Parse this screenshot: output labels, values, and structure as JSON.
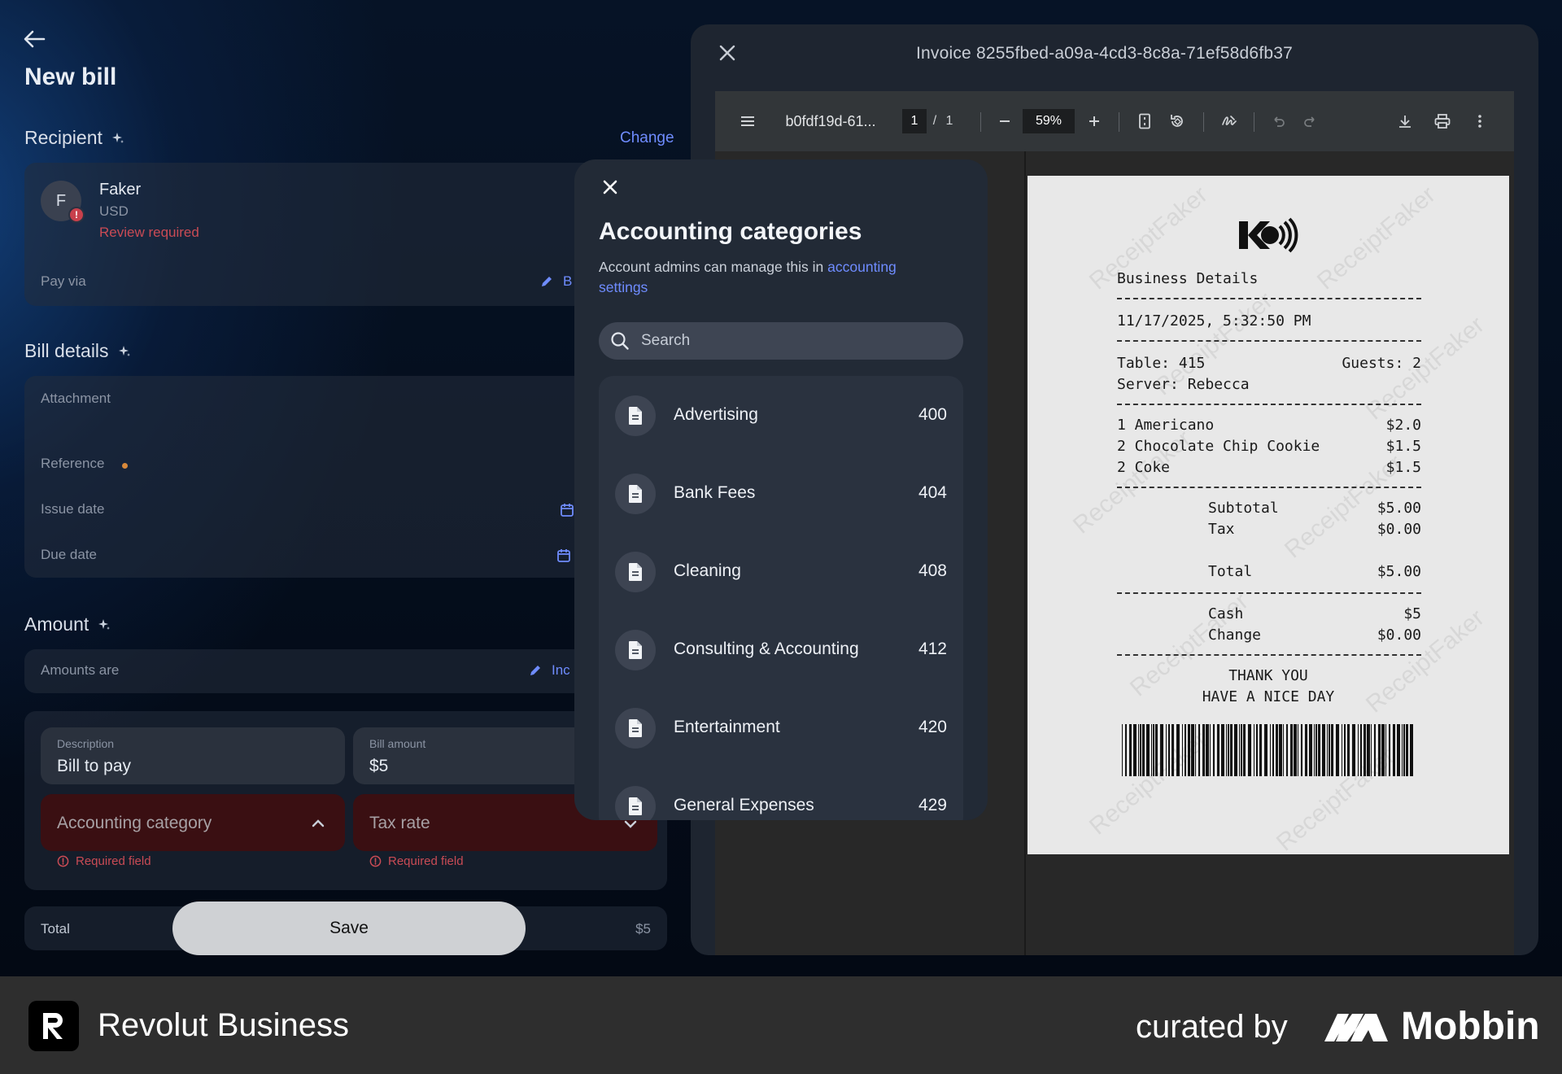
{
  "form": {
    "title": "New bill",
    "recipient_title": "Recipient",
    "change_link": "Change",
    "recipient": {
      "initial": "F",
      "name": "Faker",
      "currency": "USD",
      "status": "Review required"
    },
    "pay_via_label": "Pay via",
    "pay_via_value": "B",
    "bill_details_title": "Bill details",
    "attachment_label": "Attachment",
    "reference_label": "Reference",
    "issue_date_label": "Issue date",
    "due_date_label": "Due date",
    "amount_title": "Amount",
    "amounts_are_label": "Amounts are",
    "amounts_are_value": "Inc",
    "description_label": "Description",
    "description_value": "Bill to pay",
    "bill_amount_label": "Bill amount",
    "bill_amount_value": "$5",
    "accounting_category_placeholder": "Accounting category",
    "tax_rate_placeholder": "Tax rate",
    "required_text": "Required field",
    "required_text_2": "Required field",
    "total_label": "Total",
    "total_value": "$5",
    "save_label": "Save"
  },
  "modal": {
    "title": "Accounting categories",
    "desc_prefix": "Account admins can manage this in ",
    "desc_link": "accounting settings",
    "search_placeholder": "Search",
    "items": [
      {
        "name": "Advertising",
        "code": "400"
      },
      {
        "name": "Bank Fees",
        "code": "404"
      },
      {
        "name": "Cleaning",
        "code": "408"
      },
      {
        "name": "Consulting & Accounting",
        "code": "412"
      },
      {
        "name": "Entertainment",
        "code": "420"
      },
      {
        "name": "General Expenses",
        "code": "429"
      }
    ]
  },
  "invoice": {
    "title": "Invoice 8255fbed-a09a-4cd3-8c8a-71ef58d6fb37",
    "file_name": "b0fdf19d-61...",
    "page_current": "1",
    "page_sep": "/",
    "page_total": "1",
    "zoom": "59%"
  },
  "receipt": {
    "heading": "Business Details",
    "datetime": "11/17/2025, 5:32:50 PM",
    "table": "Table: 415",
    "guests": "Guests: 2",
    "server": "Server: Rebecca",
    "lines": [
      {
        "item": "1 Americano",
        "price": "$2.0"
      },
      {
        "item": "2 Chocolate Chip Cookie",
        "price": "$1.5"
      },
      {
        "item": "2 Coke",
        "price": "$1.5"
      }
    ],
    "subtotal_label": "Subtotal",
    "subtotal": "$5.00",
    "tax_label": "Tax",
    "tax": "$0.00",
    "total_label": "Total",
    "total": "$5.00",
    "cash_label": "Cash",
    "cash": "$5",
    "change_label": "Change",
    "change": "$0.00",
    "thanks_1": "THANK YOU",
    "thanks_2": "HAVE A NICE DAY",
    "watermark": "ReceiptFaker"
  },
  "footer": {
    "brand": "Revolut Business",
    "curated": "curated by",
    "mobbin": "Mobbin"
  },
  "colors": {
    "accent_link": "#6f8cff",
    "error_red": "#c94b55",
    "field_error_bg": "#3a0f12",
    "modal_bg": "#222a36"
  }
}
